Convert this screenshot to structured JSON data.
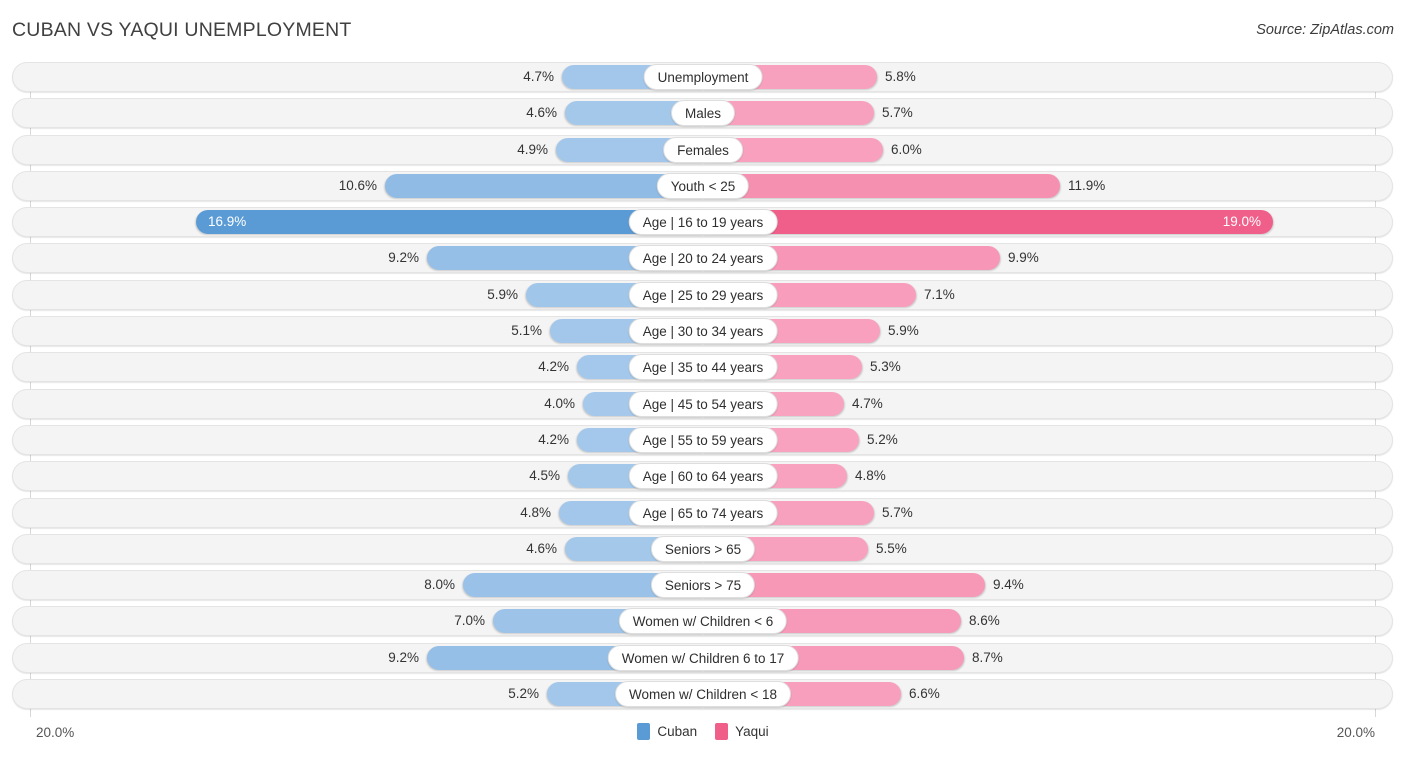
{
  "header": {
    "title": "CUBAN VS YAQUI UNEMPLOYMENT",
    "source": "Source: ZipAtlas.com"
  },
  "footer": {
    "axis_left": "20.0%",
    "axis_right": "20.0%",
    "legend": [
      {
        "label": "Cuban",
        "color": "#5b9bd5"
      },
      {
        "label": "Yaqui",
        "color": "#ef5f8a"
      }
    ]
  },
  "chart_data": {
    "type": "bar",
    "title": "CUBAN VS YAQUI UNEMPLOYMENT",
    "subtitle": "Source: ZipAtlas.com",
    "orientation": "horizontal-diverging",
    "xlabel": "",
    "ylabel": "",
    "axis_max": 20.0,
    "axis_left_label": "20.0%",
    "axis_right_label": "20.0%",
    "grid": true,
    "legend_position": "bottom-center",
    "unit": "%",
    "categories": [
      "Unemployment",
      "Males",
      "Females",
      "Youth < 25",
      "Age | 16 to 19 years",
      "Age | 20 to 24 years",
      "Age | 25 to 29 years",
      "Age | 30 to 34 years",
      "Age | 35 to 44 years",
      "Age | 45 to 54 years",
      "Age | 55 to 59 years",
      "Age | 60 to 64 years",
      "Age | 65 to 74 years",
      "Seniors > 65",
      "Seniors > 75",
      "Women w/ Children < 6",
      "Women w/ Children 6 to 17",
      "Women w/ Children < 18"
    ],
    "series": [
      {
        "name": "Cuban",
        "color": "#5b9bd5",
        "side": "left",
        "values": [
          4.7,
          4.6,
          4.9,
          10.6,
          16.9,
          9.2,
          5.9,
          5.1,
          4.2,
          4.0,
          4.2,
          4.5,
          4.8,
          4.6,
          8.0,
          7.0,
          9.2,
          5.2
        ]
      },
      {
        "name": "Yaqui",
        "color": "#ef5f8a",
        "side": "right",
        "values": [
          5.8,
          5.7,
          6.0,
          11.9,
          19.0,
          9.9,
          7.1,
          5.9,
          5.3,
          4.7,
          5.2,
          4.8,
          5.7,
          5.5,
          9.4,
          8.6,
          8.7,
          6.6
        ]
      }
    ],
    "rows": [
      {
        "label": "Unemployment",
        "left": "4.7%",
        "right": "5.8%",
        "left_value": 4.7,
        "right_value": 5.8,
        "highlight": false
      },
      {
        "label": "Males",
        "left": "4.6%",
        "right": "5.7%",
        "left_value": 4.6,
        "right_value": 5.7,
        "highlight": false
      },
      {
        "label": "Females",
        "left": "4.9%",
        "right": "6.0%",
        "left_value": 4.9,
        "right_value": 6.0,
        "highlight": false
      },
      {
        "label": "Youth < 25",
        "left": "10.6%",
        "right": "11.9%",
        "left_value": 10.6,
        "right_value": 11.9,
        "highlight": false
      },
      {
        "label": "Age | 16 to 19 years",
        "left": "16.9%",
        "right": "19.0%",
        "left_value": 16.9,
        "right_value": 19.0,
        "highlight": true
      },
      {
        "label": "Age | 20 to 24 years",
        "left": "9.2%",
        "right": "9.9%",
        "left_value": 9.2,
        "right_value": 9.9,
        "highlight": false
      },
      {
        "label": "Age | 25 to 29 years",
        "left": "5.9%",
        "right": "7.1%",
        "left_value": 5.9,
        "right_value": 7.1,
        "highlight": false
      },
      {
        "label": "Age | 30 to 34 years",
        "left": "5.1%",
        "right": "5.9%",
        "left_value": 5.1,
        "right_value": 5.9,
        "highlight": false
      },
      {
        "label": "Age | 35 to 44 years",
        "left": "4.2%",
        "right": "5.3%",
        "left_value": 4.2,
        "right_value": 5.3,
        "highlight": false
      },
      {
        "label": "Age | 45 to 54 years",
        "left": "4.0%",
        "right": "4.7%",
        "left_value": 4.0,
        "right_value": 4.7,
        "highlight": false
      },
      {
        "label": "Age | 55 to 59 years",
        "left": "4.2%",
        "right": "5.2%",
        "left_value": 4.2,
        "right_value": 5.2,
        "highlight": false
      },
      {
        "label": "Age | 60 to 64 years",
        "left": "4.5%",
        "right": "4.8%",
        "left_value": 4.5,
        "right_value": 4.8,
        "highlight": false
      },
      {
        "label": "Age | 65 to 74 years",
        "left": "4.8%",
        "right": "5.7%",
        "left_value": 4.8,
        "right_value": 5.7,
        "highlight": false
      },
      {
        "label": "Seniors > 65",
        "left": "4.6%",
        "right": "5.5%",
        "left_value": 4.6,
        "right_value": 5.5,
        "highlight": false
      },
      {
        "label": "Seniors > 75",
        "left": "8.0%",
        "right": "9.4%",
        "left_value": 8.0,
        "right_value": 9.4,
        "highlight": false
      },
      {
        "label": "Women w/ Children < 6",
        "left": "7.0%",
        "right": "8.6%",
        "left_value": 7.0,
        "right_value": 8.6,
        "highlight": false
      },
      {
        "label": "Women w/ Children 6 to 17",
        "left": "9.2%",
        "right": "8.7%",
        "left_value": 9.2,
        "right_value": 8.7,
        "highlight": false
      },
      {
        "label": "Women w/ Children < 18",
        "left": "5.2%",
        "right": "6.6%",
        "left_value": 5.2,
        "right_value": 6.6,
        "highlight": false
      }
    ]
  }
}
